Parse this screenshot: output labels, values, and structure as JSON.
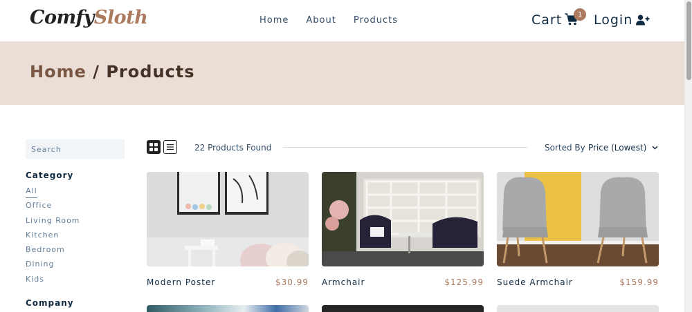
{
  "brand": {
    "part1": "Comfy",
    "part2": "Sloth"
  },
  "nav": {
    "links": [
      "Home",
      "About",
      "Products"
    ]
  },
  "cart": {
    "label": "Cart",
    "count": "1"
  },
  "login": {
    "label": "Login"
  },
  "hero": {
    "home": "Home",
    "separator": " / ",
    "current": "Products"
  },
  "filters": {
    "search_placeholder": "Search",
    "category_heading": "Category",
    "categories": [
      "All",
      "Office",
      "Living Room",
      "Kitchen",
      "Bedroom",
      "Dining",
      "Kids"
    ],
    "active_category": "All",
    "company_heading": "Company"
  },
  "toolbar": {
    "found": "22 Products Found",
    "sort_label": "Sorted By",
    "sort_value": "Price (Lowest)"
  },
  "products": [
    {
      "name": "Modern Poster",
      "price": "$30.99"
    },
    {
      "name": "Armchair",
      "price": "$125.99"
    },
    {
      "name": "Suede Armchair",
      "price": "$159.99"
    }
  ],
  "colors": {
    "brand": "#ab7a5f",
    "hero_bg": "#eaded7",
    "hero_text": "#453227"
  }
}
